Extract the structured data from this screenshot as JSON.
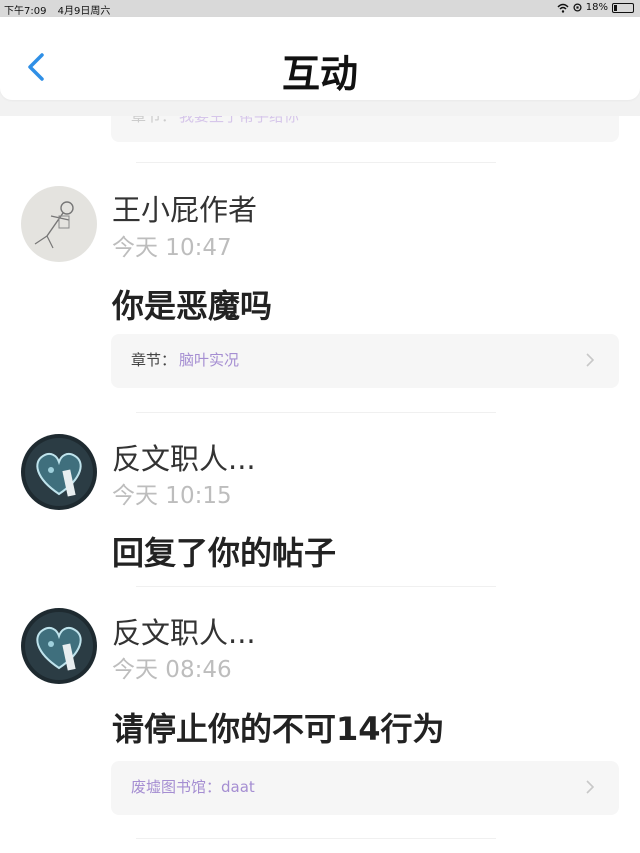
{
  "status_bar": {
    "time": "下午7:09",
    "date": "4月9日周六",
    "battery": "18%"
  },
  "nav": {
    "title": "互动"
  },
  "top_card": {
    "label": "章节：",
    "value": "我要生了帮手给你"
  },
  "items": [
    {
      "author": "王小屁作者",
      "time": "今天 10:47",
      "message": "你是恶魔吗",
      "chapter_label": "章节：",
      "chapter_value": "脑叶实况"
    },
    {
      "author": "反文职人...",
      "time": "今天 10:15",
      "message": "回复了你的帖子"
    },
    {
      "author": "反文职人...",
      "time": "今天 08:46",
      "message": "请停止你的不可14行为",
      "chapter_full": "废墟图书馆：daat"
    }
  ],
  "colors": {
    "accent_blue": "#2f8fe6",
    "chapter_purple": "#a58ed2"
  },
  "icons": {
    "back": "chevron-left-icon",
    "chevron": "chevron-right-icon",
    "wifi": "wifi-icon",
    "battery": "battery-icon"
  }
}
